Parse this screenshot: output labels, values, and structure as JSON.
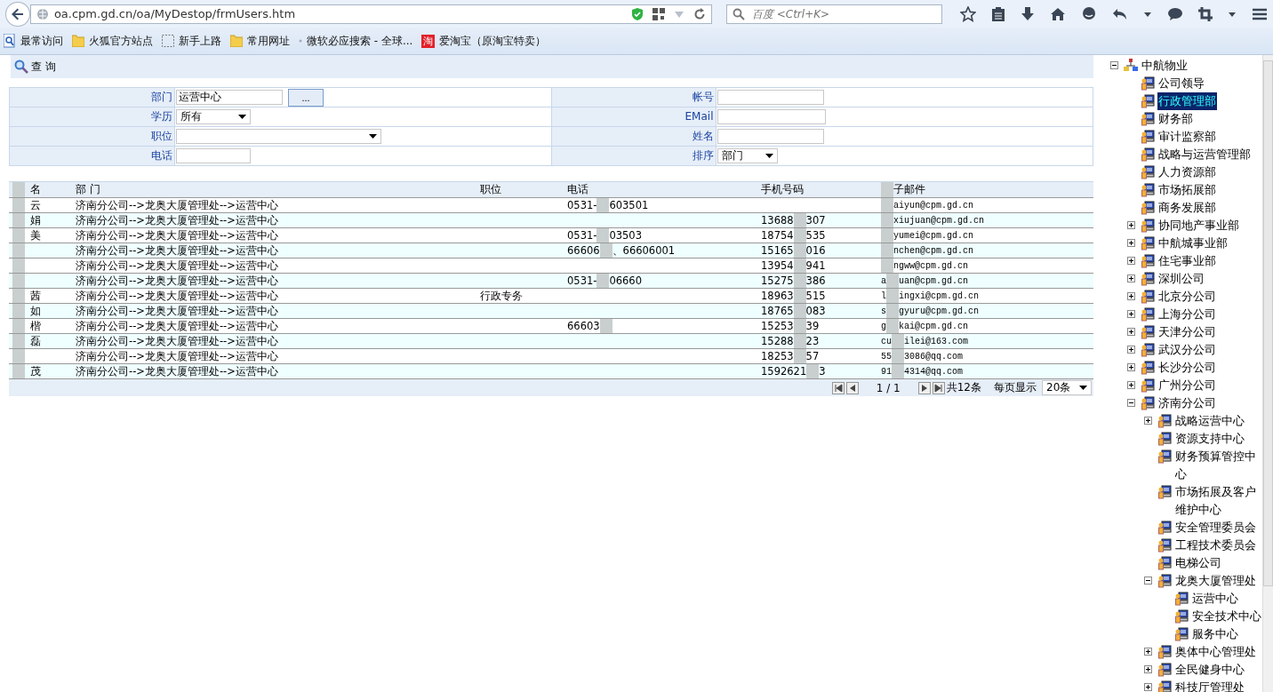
{
  "browser": {
    "url": "oa.cpm.gd.cn/oa/MyDestop/frmUsers.htm",
    "search_placeholder": "百度 <Ctrl+K>",
    "bookmarks": [
      {
        "kind": "special",
        "label": "最常访问"
      },
      {
        "kind": "folder",
        "label": "火狐官方站点"
      },
      {
        "kind": "page",
        "label": "新手上路"
      },
      {
        "kind": "folder",
        "label": "常用网址"
      },
      {
        "kind": "plain",
        "label": "微软必应搜索 - 全球..."
      },
      {
        "kind": "taobao",
        "label": "爱淘宝（原淘宝特卖）",
        "icon_text": "淘"
      }
    ]
  },
  "toolbar": {
    "query_button": "查 询"
  },
  "form": {
    "left": [
      {
        "label": "部门",
        "kind": "picker",
        "value": "运营中心",
        "button": "..."
      },
      {
        "label": "学历",
        "kind": "select",
        "value": "所有"
      },
      {
        "label": "职位",
        "kind": "select_wide"
      },
      {
        "label": "电话",
        "kind": "input"
      }
    ],
    "right": [
      {
        "label": "帐号",
        "kind": "input"
      },
      {
        "label": "EMail",
        "kind": "input_wide"
      },
      {
        "label": "姓名",
        "kind": "input"
      },
      {
        "label": "排序",
        "kind": "select",
        "value": "部门"
      }
    ]
  },
  "table": {
    "columns": [
      "名",
      "部 门",
      "职位",
      "电话",
      "手机号码",
      "子邮件"
    ],
    "rows": [
      {
        "name": "云",
        "dept": "济南分公司-->龙奥大厦管理处-->运营中心",
        "phone": {
          "pre": "0531-",
          "post": "603501"
        },
        "email": {
          "post": "aiyun@cpm.gd.cn"
        }
      },
      {
        "name": "娟",
        "dept": "济南分公司-->龙奥大厦管理处-->运营中心",
        "mobile": {
          "pre": "13688",
          "post": "307"
        },
        "email": {
          "post": "xiujuan@cpm.gd.cn"
        }
      },
      {
        "name": "美",
        "dept": "济南分公司-->龙奥大厦管理处-->运营中心",
        "phone": {
          "pre": "0531-",
          "post": "03503"
        },
        "mobile": {
          "pre": "18754",
          "post": "535"
        },
        "email": {
          "post": "yumei@cpm.gd.cn"
        }
      },
      {
        "dept": "济南分公司-->龙奥大厦管理处-->运营中心",
        "phone": {
          "pre": "66606",
          "post": "、66606001"
        },
        "mobile": {
          "pre": "15165",
          "post": "016"
        },
        "email": {
          "post": "nchen@cpm.gd.cn"
        }
      },
      {
        "dept": "济南分公司-->龙奥大厦管理处-->运营中心",
        "mobile": {
          "pre": "13954",
          "post": "941"
        },
        "email": {
          "post": "ngww@cpm.gd.cn"
        }
      },
      {
        "dept": "济南分公司-->龙奥大厦管理处-->运营中心",
        "phone": {
          "pre": "0531-",
          "post": "06660"
        },
        "mobile": {
          "pre": "15275",
          "post": "386"
        },
        "email": {
          "pre": "a",
          "post": "uan@cpm.gd.cn"
        }
      },
      {
        "name": "茜",
        "dept": "济南分公司-->龙奥大厦管理处-->运营中心",
        "position": "行政专务",
        "mobile": {
          "pre": "18963",
          "post": "515"
        },
        "email": {
          "pre": "l",
          "post": "ingxi@cpm.gd.cn"
        }
      },
      {
        "name": "如",
        "dept": "济南分公司-->龙奥大厦管理处-->运营中心",
        "mobile": {
          "pre": "18765",
          "post": "083"
        },
        "email": {
          "pre": "s",
          "post": "gyuru@cpm.gd.cn"
        }
      },
      {
        "name": "楷",
        "dept": "济南分公司-->龙奥大厦管理处-->运营中心",
        "phone": {
          "pre": "66603"
        },
        "mobile": {
          "pre": "15253",
          "post": "39"
        },
        "email": {
          "pre": "g",
          "post": "kai@cpm.gd.cn"
        }
      },
      {
        "name": "磊",
        "dept": "济南分公司-->龙奥大厦管理处-->运营中心",
        "mobile": {
          "pre": "15288",
          "post": "23"
        },
        "email": {
          "pre": "cu",
          "post": "ilei@163.com"
        }
      },
      {
        "dept": "济南分公司-->龙奥大厦管理处-->运营中心",
        "mobile": {
          "pre": "18253",
          "post": "57"
        },
        "email": {
          "pre": "55",
          "post": "3086@qq.com"
        }
      },
      {
        "name": "茂",
        "dept": "济南分公司-->龙奥大厦管理处-->运营中心",
        "mobile": {
          "pre": "1592621",
          "post": "3"
        },
        "email": {
          "pre": "91",
          "post": "4314@qq.com"
        }
      }
    ],
    "pager": {
      "pages": "1 / 1",
      "total": "共12条",
      "per_page_label": "每页显示",
      "per_page": "20条"
    }
  },
  "tree": {
    "label": "中航物业",
    "kind": "root",
    "expanded": true,
    "selected": false,
    "children": [
      {
        "label": "公司领导",
        "selected": false
      },
      {
        "label": "行政管理部",
        "selected": true
      },
      {
        "label": "财务部",
        "selected": false
      },
      {
        "label": "审计监察部",
        "selected": false
      },
      {
        "label": "战略与运营管理部",
        "selected": false
      },
      {
        "label": "人力资源部",
        "selected": false
      },
      {
        "label": "市场拓展部",
        "selected": false
      },
      {
        "label": "商务发展部",
        "selected": false
      },
      {
        "label": "协同地产事业部",
        "selected": false,
        "expanded": false
      },
      {
        "label": "中航城事业部",
        "selected": false,
        "expanded": false
      },
      {
        "label": "住宅事业部",
        "selected": false,
        "expanded": false
      },
      {
        "label": "深圳公司",
        "selected": false,
        "expanded": false
      },
      {
        "label": "北京分公司",
        "selected": false,
        "expanded": false
      },
      {
        "label": "上海分公司",
        "selected": false,
        "expanded": false
      },
      {
        "label": "天津分公司",
        "selected": false,
        "expanded": false
      },
      {
        "label": "武汉分公司",
        "selected": false,
        "expanded": false
      },
      {
        "label": "长沙分公司",
        "selected": false,
        "expanded": false
      },
      {
        "label": "广州分公司",
        "selected": false,
        "expanded": false
      },
      {
        "label": "济南分公司",
        "selected": false,
        "expanded": true,
        "children": [
          {
            "label": "战略运营中心",
            "selected": false,
            "expanded": false
          },
          {
            "label": "资源支持中心",
            "selected": false
          },
          {
            "label": "财务预算管控中心",
            "selected": false
          },
          {
            "label": "市场拓展及客户维护中心",
            "selected": false
          },
          {
            "label": "安全管理委员会",
            "selected": false
          },
          {
            "label": "工程技术委员会",
            "selected": false
          },
          {
            "label": "电梯公司",
            "selected": false
          },
          {
            "label": "龙奥大厦管理处",
            "selected": false,
            "expanded": true,
            "children": [
              {
                "label": "运营中心",
                "selected": false
              },
              {
                "label": "安全技术中心",
                "selected": false
              },
              {
                "label": "服务中心",
                "selected": false
              }
            ]
          },
          {
            "label": "奥体中心管理处",
            "selected": false,
            "expanded": false
          },
          {
            "label": "全民健身中心",
            "selected": false,
            "expanded": false
          },
          {
            "label": "科技厅管理处",
            "selected": false,
            "expanded": false
          }
        ]
      }
    ]
  }
}
